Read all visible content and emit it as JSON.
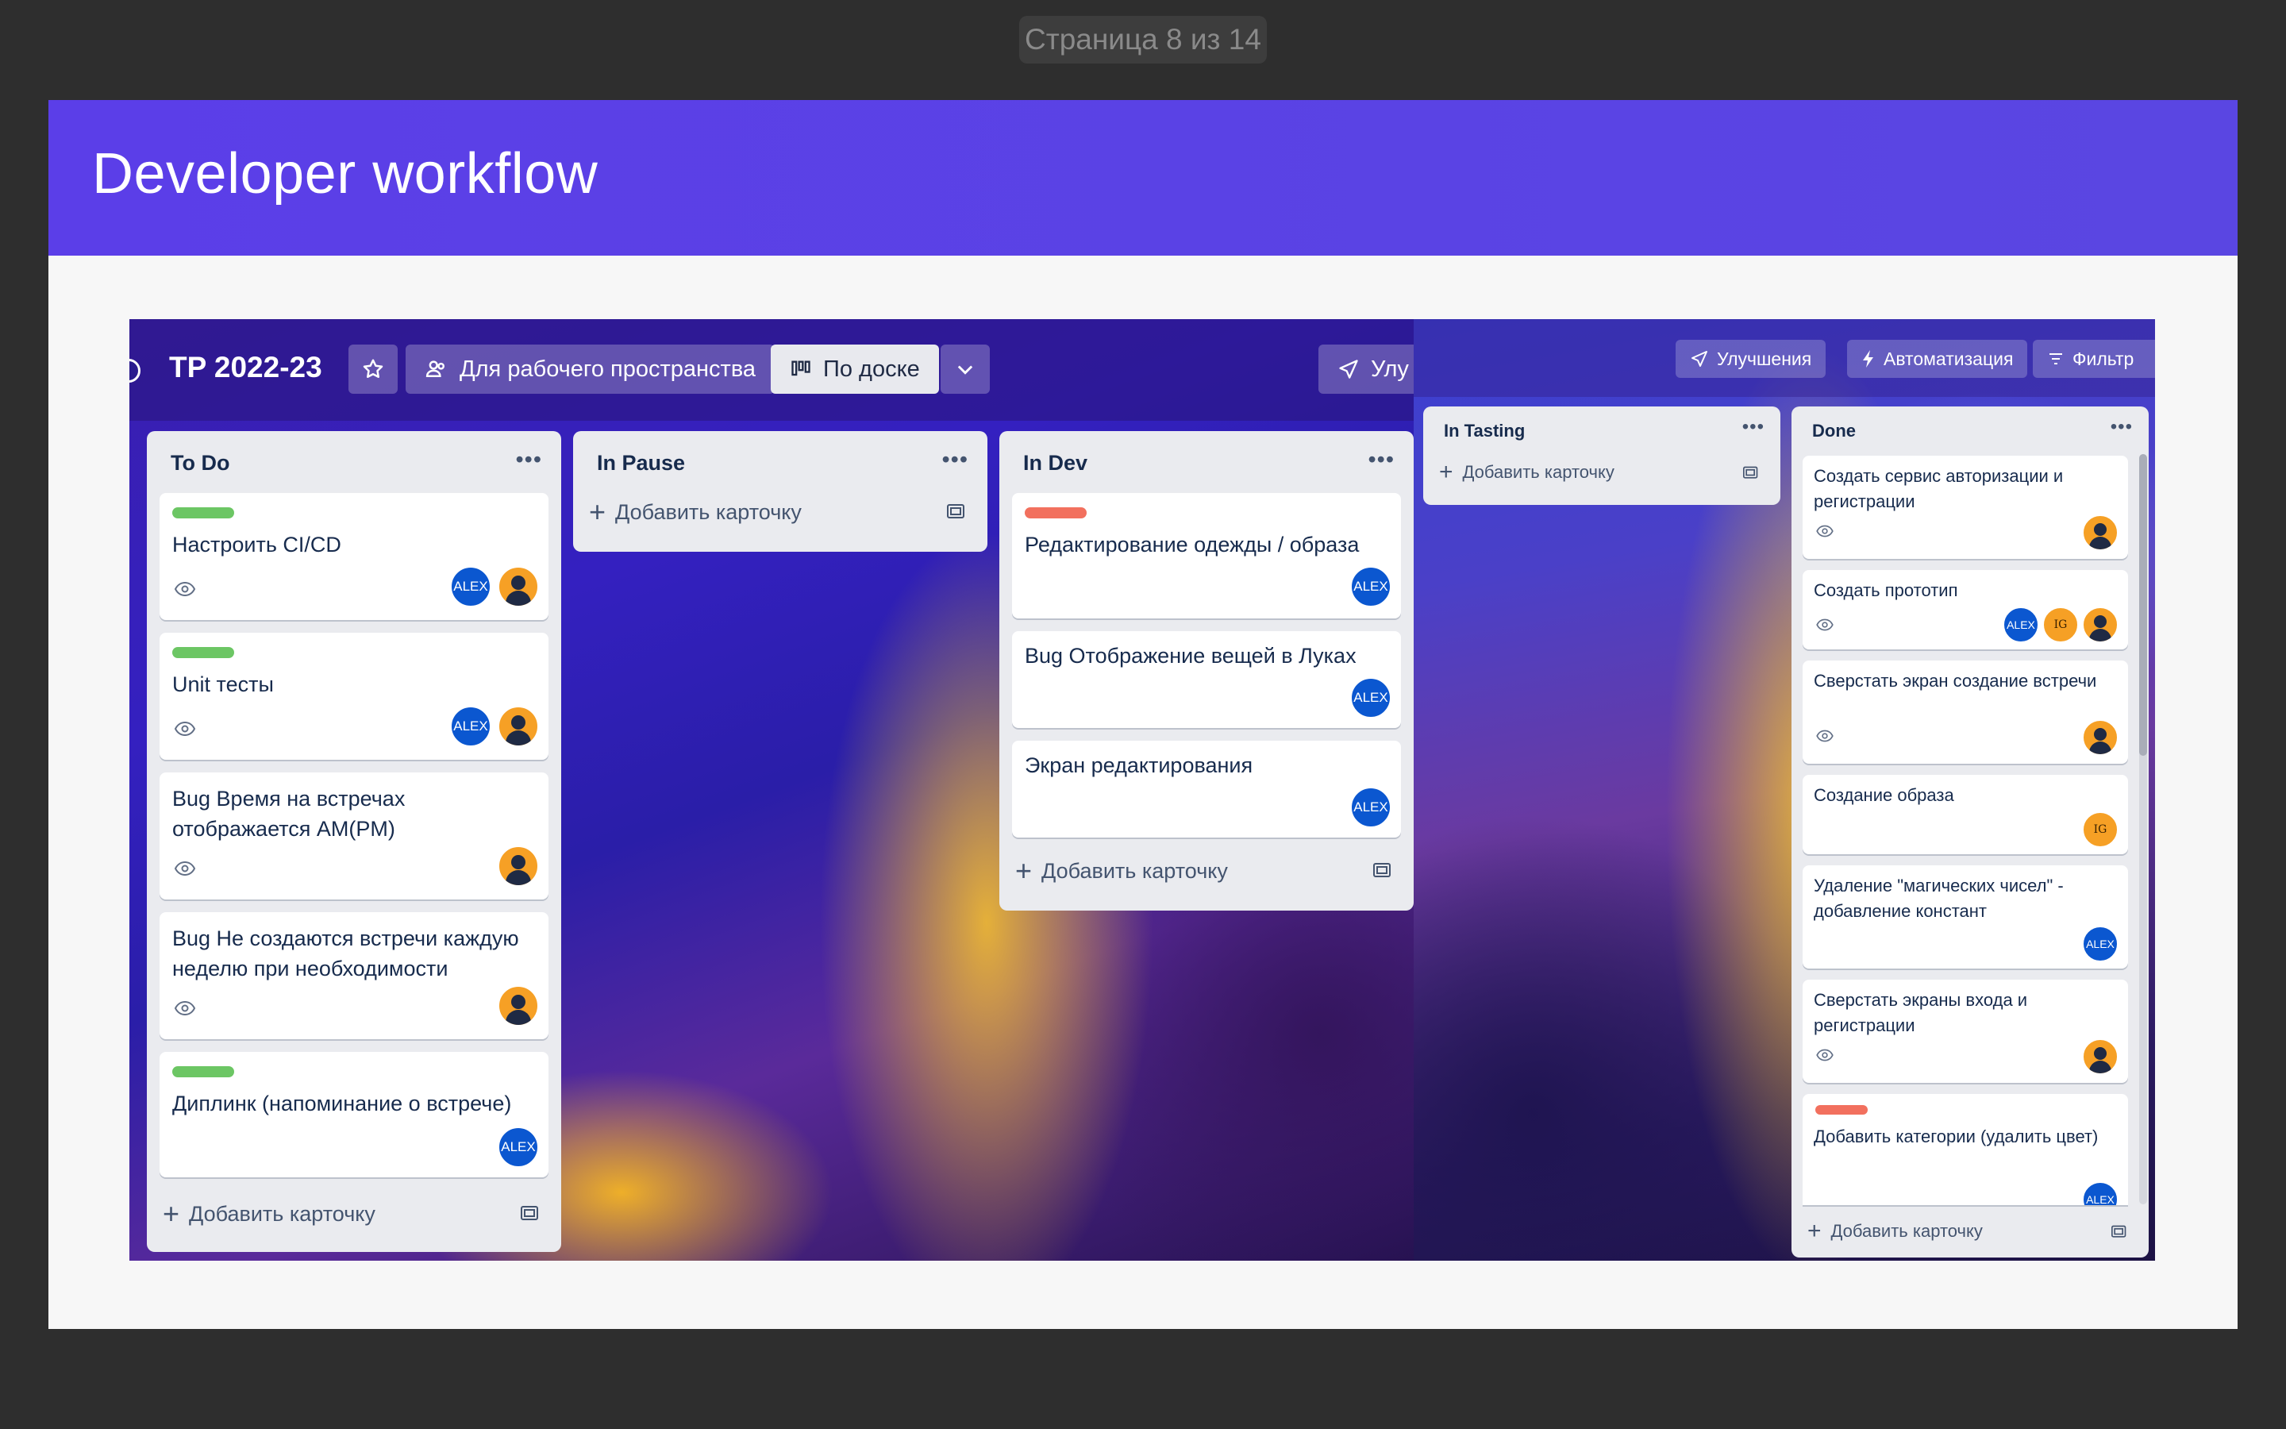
{
  "viewer": {
    "page_indicator": "Страница 8 из 14"
  },
  "slide": {
    "title": "Developer workflow"
  },
  "board": {
    "title": "TP 2022-23",
    "toolbar": {
      "workspace_label": "Для рабочего пространства",
      "view_label": "По доске",
      "improvements_partial": "Улу",
      "improvements_label": "Улучшения",
      "automation_label": "Автоматизация",
      "filters_partial": "Фильтр"
    },
    "add_card_label": "Добавить карточку",
    "lists": {
      "todo": {
        "title": "To Do",
        "cards": [
          {
            "text": "Настроить CI/CD",
            "label_color": "#6cc664",
            "avatars": [
              "ALEX",
              "person"
            ]
          },
          {
            "text": "Unit тесты",
            "label_color": "#6cc664",
            "avatars": [
              "ALEX",
              "person"
            ]
          },
          {
            "text": "Bug Время на встречах отображается AM(PM)",
            "avatars": [
              "person"
            ]
          },
          {
            "text": "Bug Не создаются встречи каждую неделю при необходимости",
            "avatars": [
              "person"
            ]
          },
          {
            "text": "Диплинк (напоминание о встрече)",
            "label_color": "#6cc664",
            "avatars": [
              "ALEX"
            ]
          }
        ]
      },
      "pause": {
        "title": "In Pause",
        "cards": []
      },
      "dev": {
        "title": "In Dev",
        "cards": [
          {
            "text": "Редактирование одежды / образа",
            "label_color": "#f2705e",
            "avatars": [
              "ALEX"
            ]
          },
          {
            "text": "Bug Отображение вещей в Луках",
            "avatars": [
              "ALEX"
            ]
          },
          {
            "text": "Экран редактирования",
            "avatars": [
              "ALEX"
            ]
          }
        ]
      },
      "tasting": {
        "title": "In Tasting",
        "cards": []
      },
      "done": {
        "title": "Done",
        "cards": [
          {
            "text": "Создать сервис авторизации и регистрации",
            "avatars": [
              "person"
            ]
          },
          {
            "text": "Создать прототип",
            "avatars": [
              "ALEX",
              "IG",
              "person"
            ]
          },
          {
            "text": "Сверстать экран создание встречи",
            "avatars": [
              "person"
            ]
          },
          {
            "text": "Создание образа",
            "avatars": [
              "IG"
            ]
          },
          {
            "text": "Удаление \"магических чисел\" - добавление констант",
            "avatars": [
              "ALEX"
            ]
          },
          {
            "text": "Сверстать экраны входа и регистрации",
            "avatars": [
              "person"
            ]
          },
          {
            "text": "Добавить категории (удалить цвет)",
            "label_color": "#f2705e",
            "avatars": [
              "ALEX"
            ]
          }
        ]
      }
    },
    "avatar_initials": {
      "alex": "ALEX",
      "ig": "IG"
    }
  }
}
